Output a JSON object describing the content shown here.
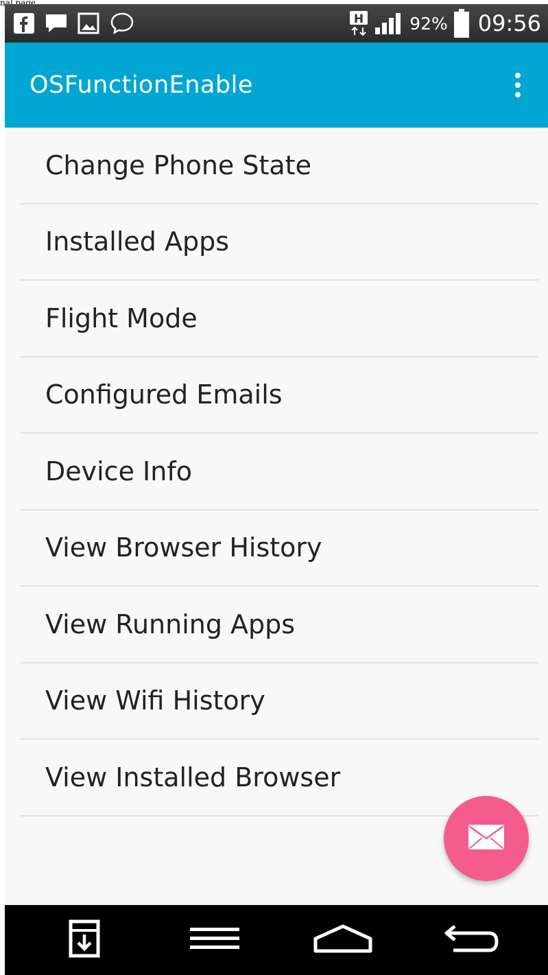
{
  "caption": "nal page",
  "status_bar": {
    "left_icons": [
      "facebook-icon",
      "message-icon",
      "gallery-icon",
      "messenger-icon"
    ],
    "network_type": "H",
    "battery_percent": "92%",
    "time": "09:56"
  },
  "app_bar": {
    "title": "OSFunctionEnable",
    "overflow_icon": "more-vert-icon"
  },
  "menu": {
    "items": [
      {
        "label": "Change Phone State"
      },
      {
        "label": "Installed Apps"
      },
      {
        "label": "Flight Mode"
      },
      {
        "label": "Configured Emails"
      },
      {
        "label": "Device Info"
      },
      {
        "label": "View Browser History"
      },
      {
        "label": "View Running Apps"
      },
      {
        "label": "View Wifi History"
      },
      {
        "label": "View Installed Browser"
      }
    ]
  },
  "fab": {
    "icon": "mail-icon",
    "color": "#f45c8d"
  },
  "nav_bar": {
    "buttons": [
      "download-icon",
      "menu-icon",
      "home-icon",
      "back-icon"
    ]
  },
  "colors": {
    "accent": "#02a6d3",
    "fab": "#f45c8d",
    "background": "#f8f8f8",
    "divider": "#e2e2e2"
  }
}
